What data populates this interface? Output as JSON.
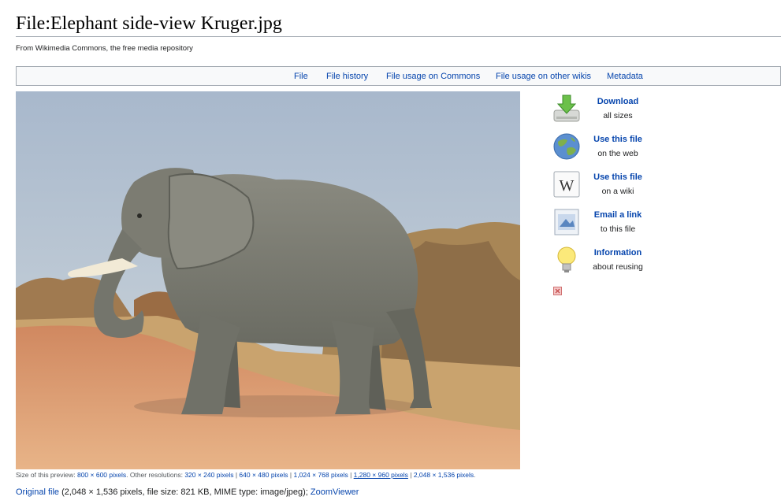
{
  "page": {
    "title": "File:Elephant side-view Kruger.jpg",
    "subtitle": "From Wikimedia Commons, the free media repository"
  },
  "toc": {
    "items": [
      {
        "label": "File"
      },
      {
        "label": "File history"
      },
      {
        "label": "File usage on Commons"
      },
      {
        "label": "File usage on other wikis"
      },
      {
        "label": "Metadata"
      }
    ]
  },
  "tools": [
    {
      "title": "Download",
      "subtitle": "all sizes",
      "icon": "download-icon"
    },
    {
      "title": "Use this file",
      "subtitle": "on the web",
      "icon": "globe-icon"
    },
    {
      "title": "Use this file",
      "subtitle": "on a wiki",
      "icon": "wikipedia-w-icon"
    },
    {
      "title": "Email a link",
      "subtitle": "to this file",
      "icon": "email-icon"
    },
    {
      "title": "Information",
      "subtitle": "about reusing",
      "icon": "lightbulb-icon"
    }
  ],
  "preview": {
    "size_label": "Size of this preview:",
    "size_link": "800 × 600 pixels",
    "other_label": ". Other resolutions:",
    "resolutions": [
      "320 × 240 pixels",
      "640 × 480 pixels",
      "1,024 × 768 pixels",
      "1,280 × 960 pixels",
      "2,048 × 1,536 pixels"
    ],
    "separator": " | ",
    "end": "."
  },
  "file_info": {
    "original_link": "Original file",
    "details": " (2,048 × 1,536 pixels, file size: 821 KB, MIME type: image/jpeg); ",
    "zoom_link": "ZoomViewer"
  },
  "colors": {
    "link": "#0645ad",
    "border": "#a2a9b1",
    "toc_bg": "#f8f9fa"
  }
}
